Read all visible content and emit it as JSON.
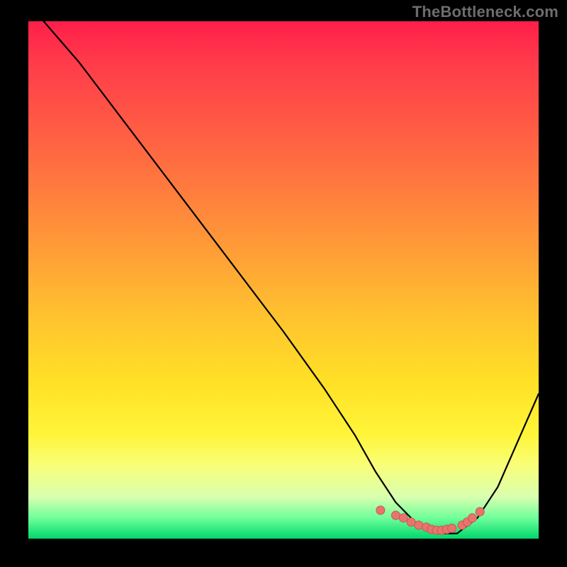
{
  "watermark": "TheBottleneck.com",
  "colors": {
    "background": "#000000",
    "curve": "#000000",
    "marker_fill": "#e8746d",
    "marker_stroke": "#c45a54",
    "gradient_top": "#ff1f4a",
    "gradient_bottom": "#00d76b"
  },
  "chart_data": {
    "type": "line",
    "title": "",
    "xlabel": "",
    "ylabel": "",
    "xlim": [
      0,
      100
    ],
    "ylim": [
      0,
      100
    ],
    "x": [
      3,
      10,
      20,
      30,
      40,
      50,
      58,
      64,
      68,
      72,
      76,
      80,
      84,
      88,
      92,
      100
    ],
    "y": [
      100,
      92,
      79,
      66,
      53,
      40,
      29,
      20,
      13,
      7,
      3,
      1,
      1,
      4,
      10,
      28
    ],
    "markers": {
      "x": [
        69,
        72,
        73.5,
        75,
        76.5,
        78,
        79,
        80,
        81,
        82,
        83,
        85,
        86,
        87,
        88.5
      ],
      "y": [
        5.5,
        4.5,
        4,
        3.2,
        2.6,
        2.2,
        1.8,
        1.6,
        1.6,
        1.8,
        2,
        2.6,
        3.2,
        4,
        5.2
      ]
    },
    "grid": false,
    "legend": false
  }
}
